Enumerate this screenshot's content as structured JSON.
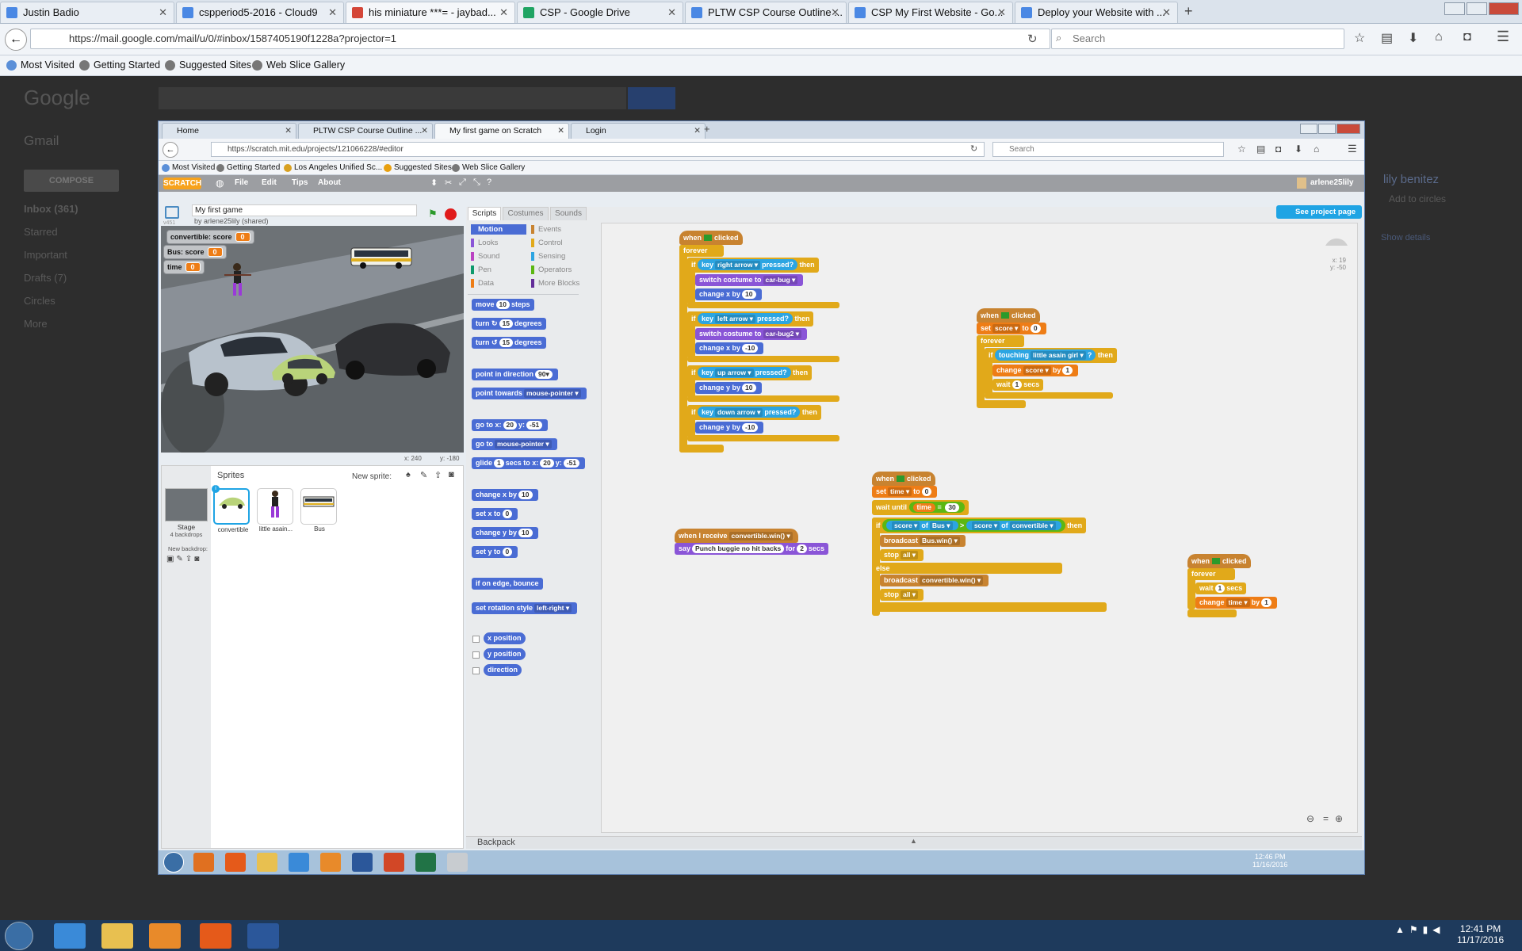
{
  "outer_browser": {
    "tabs": [
      {
        "label": "Justin Badio",
        "color": "#4a88e4"
      },
      {
        "label": "cspperiod5-2016 - Cloud9",
        "color": "#4a88e4"
      },
      {
        "label": "his miniature ***= - jaybad...",
        "color": "#d44638"
      },
      {
        "label": "CSP - Google Drive",
        "color": "#1fa463"
      },
      {
        "label": "PLTW CSP Course Outline ...",
        "color": "#4a88e4"
      },
      {
        "label": "CSP My First Website - Go...",
        "color": "#4a88e4"
      },
      {
        "label": "Deploy your Website with ...",
        "color": "#4a88e4"
      }
    ],
    "url": "https://mail.google.com/mail/u/0/#inbox/1587405190f1228a?projector=1",
    "search_placeholder": "Search",
    "bookmarks": [
      "Most Visited",
      "Getting Started",
      "Suggested Sites",
      "Web Slice Gallery"
    ]
  },
  "gmail": {
    "logo": "Google",
    "app": "Gmail",
    "compose": "COMPOSE",
    "nav": [
      "Inbox (361)",
      "Starred",
      "Important",
      "Drafts (7)",
      "Circles",
      "More"
    ],
    "contact_name": "lily benitez",
    "add_circles": "Add to circles",
    "show_details": "Show details"
  },
  "inner_browser": {
    "tabs": [
      "Home",
      "PLTW CSP Course Outline ...",
      "My first game on Scratch",
      "Login"
    ],
    "url": "https://scratch.mit.edu/projects/121066228/#editor",
    "search_placeholder": "Search",
    "bookmarks": [
      "Most Visited",
      "Getting Started",
      "Los Angeles Unified Sc...",
      "Suggested Sites",
      "Web Slice Gallery"
    ]
  },
  "scratch": {
    "menu": [
      "File",
      "Edit",
      "Tips",
      "About"
    ],
    "user": "arlene25lily",
    "project_title": "My first game",
    "author": "by arlene25lily (shared)",
    "version": "v451",
    "tabs": [
      "Scripts",
      "Costumes",
      "Sounds"
    ],
    "see_project": "See project page",
    "monitors": [
      {
        "label": "convertible: score",
        "value": "0"
      },
      {
        "label": "Bus: score",
        "value": "0"
      },
      {
        "label": "time",
        "value": "0"
      }
    ],
    "stage_coords": {
      "x": "x: 240",
      "y": "y: -180"
    },
    "sprite_coords": {
      "x": "x: 19",
      "y": "y: -50"
    },
    "sprites_label": "Sprites",
    "new_sprite": "New sprite:",
    "stage_label": "Stage",
    "backdrops": "4 backdrops",
    "new_backdrop": "New backdrop:",
    "sprites": [
      "convertible",
      "little asain...",
      "Bus"
    ],
    "categories_left": [
      "Motion",
      "Looks",
      "Sound",
      "Pen",
      "Data"
    ],
    "categories_right": [
      "Events",
      "Control",
      "Sensing",
      "Operators",
      "More Blocks"
    ],
    "palette": {
      "move": [
        "move",
        "10",
        "steps"
      ],
      "turn_r": [
        "turn",
        "↻",
        "15",
        "degrees"
      ],
      "turn_l": [
        "turn",
        "↺",
        "15",
        "degrees"
      ],
      "point_dir": [
        "point in direction",
        "90▾"
      ],
      "point_towards": [
        "point towards",
        "mouse-pointer ▾"
      ],
      "goto_xy": [
        "go to x:",
        "20",
        "y:",
        "-51"
      ],
      "goto": [
        "go to",
        "mouse-pointer ▾"
      ],
      "glide": [
        "glide",
        "1",
        "secs to x:",
        "20",
        "y:",
        "-51"
      ],
      "change_x": [
        "change x by",
        "10"
      ],
      "set_x": [
        "set x to",
        "0"
      ],
      "change_y": [
        "change y by",
        "10"
      ],
      "set_y": [
        "set y to",
        "0"
      ],
      "bounce": "if on edge, bounce",
      "rotation": [
        "set rotation style",
        "left-right ▾"
      ],
      "xpos": "x position",
      "ypos": "y position",
      "direction": "direction"
    },
    "scripts": {
      "s1": {
        "hat": [
          "when",
          "clicked"
        ],
        "forever": "forever",
        "if1": [
          "if",
          "key",
          "right arrow ▾",
          "pressed?",
          "then"
        ],
        "sw1": [
          "switch costume to",
          "car-bug ▾"
        ],
        "cx1": [
          "change x by",
          "10"
        ],
        "if2": [
          "if",
          "key",
          "left arrow ▾",
          "pressed?",
          "then"
        ],
        "sw2": [
          "switch costume to",
          "car-bug2 ▾"
        ],
        "cx2": [
          "change x by",
          "-10"
        ],
        "if3": [
          "if",
          "key",
          "up arrow ▾",
          "pressed?",
          "then"
        ],
        "cy1": [
          "change y by",
          "10"
        ],
        "if4": [
          "if",
          "key",
          "down arrow ▾",
          "pressed?",
          "then"
        ],
        "cy2": [
          "change y by",
          "-10"
        ]
      },
      "s2": {
        "hat": [
          "when",
          "clicked"
        ],
        "set": [
          "set",
          "score ▾",
          "to",
          "0"
        ],
        "forever": "forever",
        "if": [
          "if",
          "touching",
          "little asain girl ▾",
          "?",
          "then"
        ],
        "change": [
          "change",
          "score ▾",
          "by",
          "1"
        ],
        "wait": [
          "wait",
          "1",
          "secs"
        ]
      },
      "s3": {
        "hat": [
          "when I receive",
          "convertible.win() ▾"
        ],
        "say": [
          "say",
          "Punch buggie no hit backs",
          "for",
          "2",
          "secs"
        ]
      },
      "s4": {
        "hat": [
          "when",
          "clicked"
        ],
        "set": [
          "set",
          "time ▾",
          "to",
          "0"
        ],
        "wait": [
          "wait until",
          "time",
          "=",
          "30"
        ],
        "if": [
          "if",
          "score ▾",
          "of",
          "Bus ▾",
          ">",
          "score ▾",
          "of",
          "convertible ▾",
          "then"
        ],
        "b1": [
          "broadcast",
          "Bus.win() ▾"
        ],
        "stop1": [
          "stop",
          "all ▾"
        ],
        "else": "else",
        "b2": [
          "broadcast",
          "convertible.win() ▾"
        ],
        "stop2": [
          "stop",
          "all ▾"
        ]
      },
      "s5": {
        "hat": [
          "when",
          "clicked"
        ],
        "forever": "forever",
        "wait": [
          "wait",
          "1",
          "secs"
        ],
        "change": [
          "change",
          "time ▾",
          "by",
          "1"
        ]
      }
    },
    "backpack": "Backpack"
  },
  "inner_clock": {
    "time": "12:46 PM",
    "date": "11/16/2016"
  },
  "outer_clock": {
    "time": "12:41 PM",
    "date": "11/17/2016"
  }
}
